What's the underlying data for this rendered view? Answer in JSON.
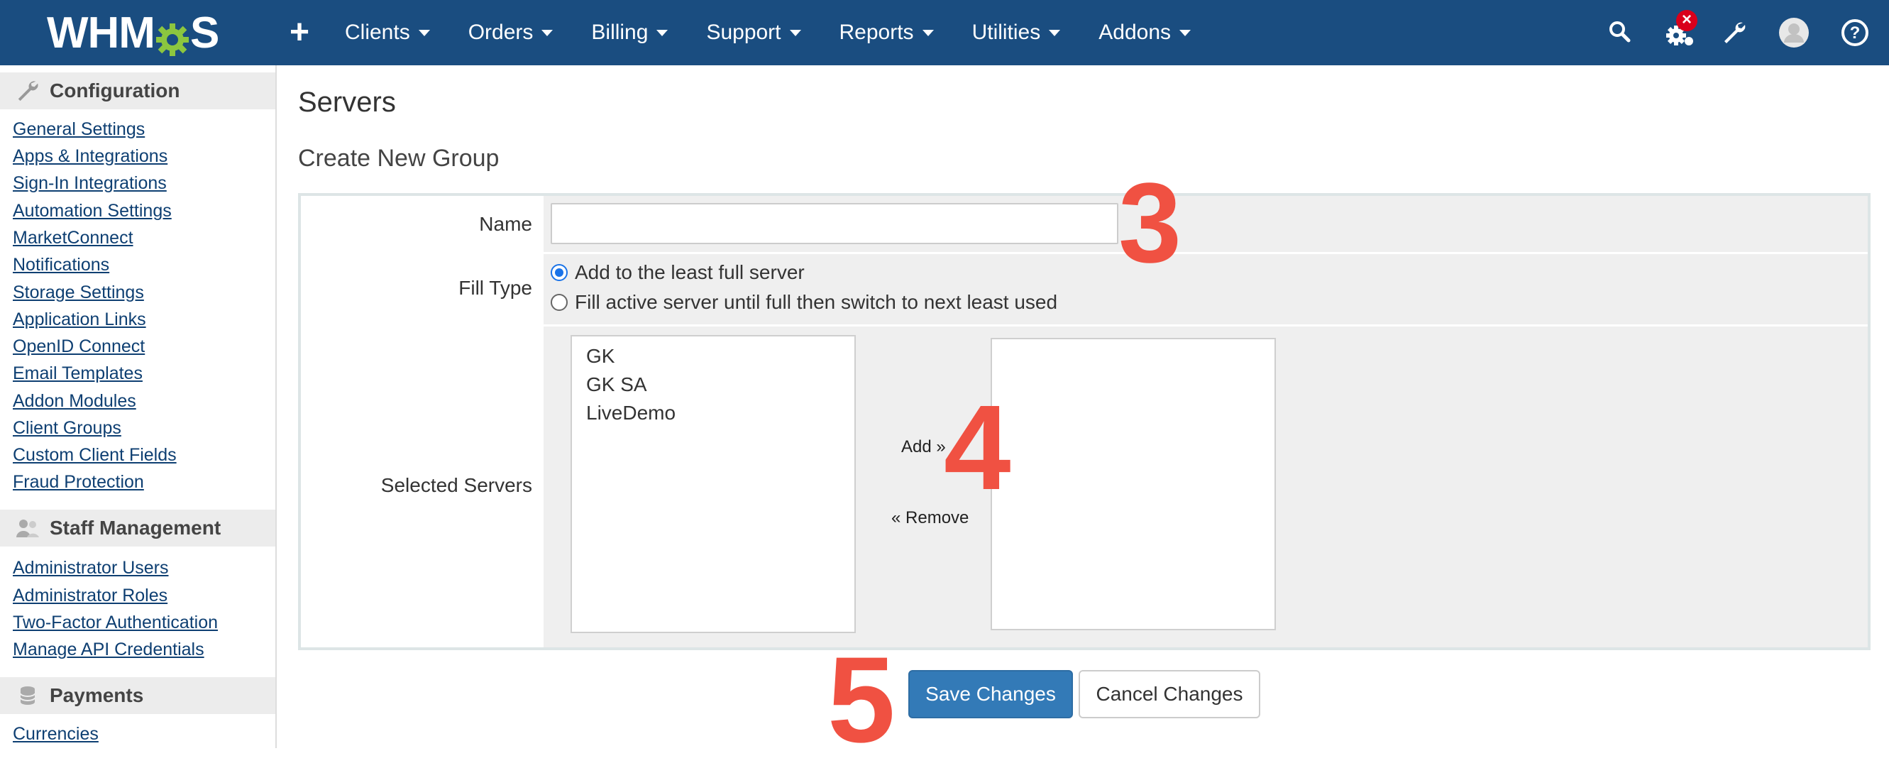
{
  "app": {
    "logo_text_left": "WHM",
    "logo_text_right": "S"
  },
  "topnav": {
    "items": [
      {
        "label": "Clients"
      },
      {
        "label": "Orders"
      },
      {
        "label": "Billing"
      },
      {
        "label": "Support"
      },
      {
        "label": "Reports"
      },
      {
        "label": "Utilities"
      },
      {
        "label": "Addons"
      }
    ],
    "icons": [
      "plus-icon",
      "search-icon",
      "gear-alert-icon",
      "wrench-icon",
      "avatar",
      "help-icon"
    ],
    "notification_badge": "×"
  },
  "sidebar": {
    "sections": [
      {
        "title": "Configuration",
        "icon": "wrench-icon",
        "links": [
          "General Settings",
          "Apps & Integrations",
          "Sign-In Integrations",
          "Automation Settings",
          "MarketConnect",
          "Notifications",
          "Storage Settings",
          "Application Links",
          "OpenID Connect",
          "Email Templates",
          "Addon Modules",
          "Client Groups",
          "Custom Client Fields",
          "Fraud Protection"
        ]
      },
      {
        "title": "Staff Management",
        "icon": "users-icon",
        "links": [
          "Administrator Users",
          "Administrator Roles",
          "Two-Factor Authentication",
          "Manage API Credentials"
        ]
      },
      {
        "title": "Payments",
        "icon": "coins-icon",
        "links": [
          "Currencies"
        ]
      }
    ]
  },
  "main": {
    "page_title": "Servers",
    "section_title": "Create New Group",
    "form": {
      "name_label": "Name",
      "name_value": "",
      "fill_type_label": "Fill Type",
      "fill_options": [
        {
          "label": "Add to the least full server",
          "checked": true
        },
        {
          "label": "Fill active server until full then switch to next least used",
          "checked": false
        }
      ],
      "selected_servers_label": "Selected Servers",
      "available_servers": [
        "GK",
        "GK SA",
        "LiveDemo"
      ],
      "selected_servers": [],
      "add_button": "Add »",
      "remove_button": "« Remove"
    },
    "save_button": "Save Changes",
    "cancel_button": "Cancel Changes"
  },
  "annotations": {
    "step3": "3",
    "step4": "4",
    "step5": "5"
  },
  "colors": {
    "nav_bg": "#1a4d80",
    "primary": "#337ab7",
    "annotation": "#f05142",
    "link": "#0e3f72",
    "badge": "#d9001b"
  }
}
